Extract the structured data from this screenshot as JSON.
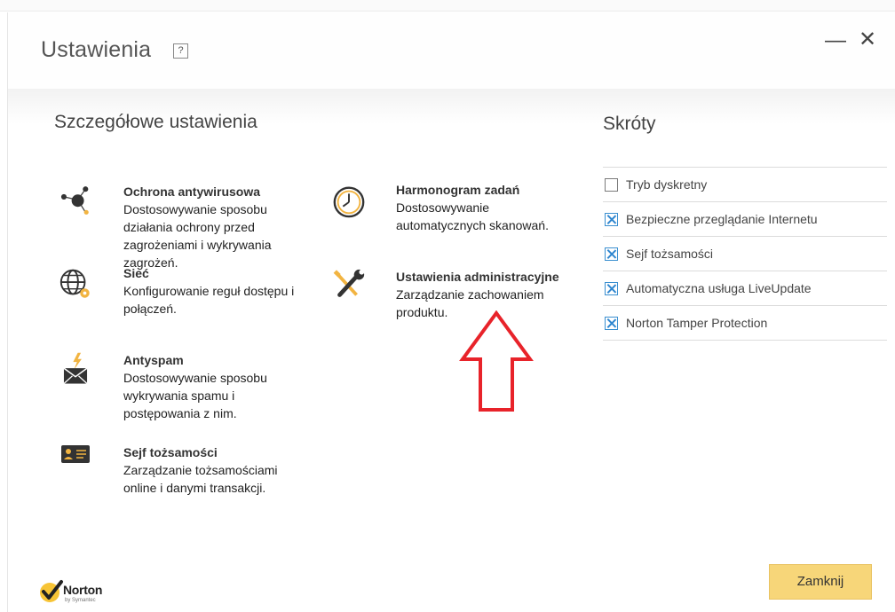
{
  "window": {
    "title": "Ustawienia",
    "help_label": "?",
    "minimize_label": "—",
    "close_label": "✕"
  },
  "details": {
    "title": "Szczegółowe ustawienia",
    "items": [
      {
        "title": "Ochrona antywirusowa",
        "desc": "Dostosowywanie sposobu działania ochrony przed zagrożeniami i wykrywania zagrożeń.",
        "icon": "antivirus-icon"
      },
      {
        "title": "Sieć",
        "desc": "Konfigurowanie reguł dostępu i połączeń.",
        "icon": "network-globe-icon"
      },
      {
        "title": "Antyspam",
        "desc": "Dostosowywanie sposobu wykrywania spamu i postępowania z nim.",
        "icon": "antispam-mail-icon"
      },
      {
        "title": "Sejf tożsamości",
        "desc": "Zarządzanie tożsamościami online i danymi transakcji.",
        "icon": "identity-card-icon"
      },
      {
        "title": "Harmonogram zadań",
        "desc": "Dostosowywanie automatycznych skanowań.",
        "icon": "clock-icon"
      },
      {
        "title": "Ustawienia administracyjne",
        "desc": "Zarządzanie zachowaniem produktu.",
        "icon": "wrench-screwdriver-icon"
      }
    ]
  },
  "shortcuts": {
    "title": "Skróty",
    "items": [
      {
        "label": "Tryb dyskretny",
        "checked": false
      },
      {
        "label": "Bezpieczne przeglądanie Internetu",
        "checked": true
      },
      {
        "label": "Sejf tożsamości",
        "checked": true
      },
      {
        "label": "Automatyczna usługa LiveUpdate",
        "checked": true
      },
      {
        "label": "Norton Tamper Protection",
        "checked": true
      }
    ]
  },
  "footer": {
    "close_button": "Zamknij",
    "logo_text": "Norton",
    "logo_sub": "by Symantec"
  },
  "colors": {
    "accent_yellow": "#f7d679",
    "checkbox_blue": "#2f86cf",
    "annotation_red": "#e8232a"
  }
}
